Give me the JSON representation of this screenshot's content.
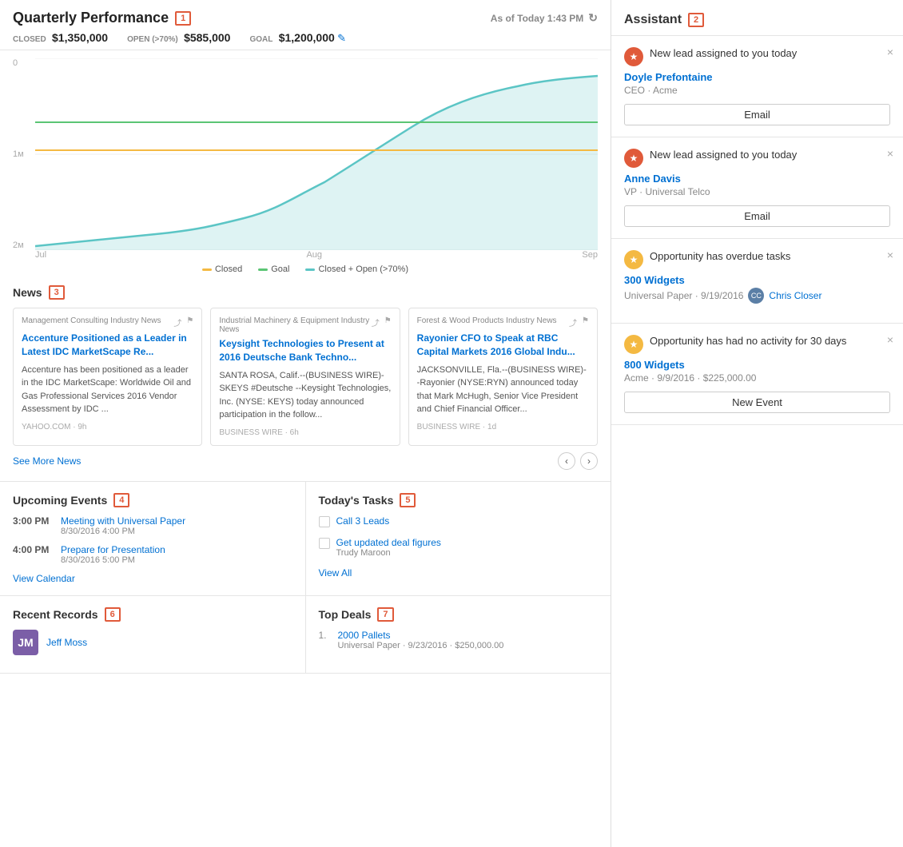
{
  "header": {
    "title": "Quarterly Performance",
    "badge": "1",
    "timestamp": "As of Today 1:43 PM",
    "closed_label": "CLOSED",
    "closed_value": "$1,350,000",
    "open_label": "OPEN (>70%)",
    "open_value": "$585,000",
    "goal_label": "GOAL",
    "goal_value": "$1,200,000"
  },
  "chart": {
    "y_labels": [
      "2м",
      "1м",
      "0"
    ],
    "x_labels": [
      "Jul",
      "Aug",
      "Sep"
    ],
    "legend": [
      {
        "label": "Closed",
        "color": "#f4b942"
      },
      {
        "label": "Goal",
        "color": "#5bc574"
      },
      {
        "label": "Closed + Open (>70%)",
        "color": "#5bc5c5"
      }
    ]
  },
  "news": {
    "section_title": "News",
    "badge": "3",
    "see_more": "See More News",
    "items": [
      {
        "source": "Management Consulting Industry News",
        "headline": "Accenture Positioned as a Leader in Latest IDC MarketScape Re...",
        "body": "Accenture has been positioned as a leader in the IDC MarketScape: Worldwide Oil and Gas Professional Services 2016 Vendor Assessment by IDC ...",
        "time": "YAHOO.COM · 9h"
      },
      {
        "source": "Industrial Machinery & Equipment Industry News",
        "headline": "Keysight Technologies to Present at 2016 Deutsche Bank Techno...",
        "body": "SANTA ROSA, Calif.--(BUSINESS WIRE)- SKEYS #Deutsche --Keysight Technologies, Inc. (NYSE: KEYS) today announced participation in the follow...",
        "time": "BUSINESS WIRE · 6h"
      },
      {
        "source": "Forest & Wood Products Industry News",
        "headline": "Rayonier CFO to Speak at RBC Capital Markets 2016 Global Indu...",
        "body": "JACKSONVILLE, Fla.--(BUSINESS WIRE)--Rayonier (NYSE:RYN) announced today that Mark McHugh, Senior Vice President and Chief Financial Officer...",
        "time": "BUSINESS WIRE · 1d"
      }
    ]
  },
  "upcoming_events": {
    "section_title": "Upcoming Events",
    "badge": "4",
    "items": [
      {
        "time": "3:00 PM",
        "name": "Meeting with Universal Paper",
        "date": "8/30/2016 4:00 PM"
      },
      {
        "time": "4:00 PM",
        "name": "Prepare for Presentation",
        "date": "8/30/2016 5:00 PM"
      }
    ],
    "view_link": "View Calendar"
  },
  "todays_tasks": {
    "section_title": "Today's Tasks",
    "badge": "5",
    "items": [
      {
        "name": "Call 3 Leads",
        "sub": ""
      },
      {
        "name": "Get updated deal figures",
        "sub": "Trudy Maroon"
      }
    ],
    "view_all": "View All"
  },
  "recent_records": {
    "section_title": "Recent Records",
    "badge": "6",
    "items": [
      {
        "name": "Jeff Moss",
        "initials": "JM"
      }
    ]
  },
  "top_deals": {
    "section_title": "Top Deals",
    "badge": "7",
    "items": [
      {
        "num": "1.",
        "name": "2000 Pallets",
        "sub": "Universal Paper · 9/23/2016 · $250,000.00"
      }
    ]
  },
  "assistant": {
    "title": "Assistant",
    "badge": "2",
    "cards": [
      {
        "type": "lead",
        "icon_type": "star",
        "title": "New lead assigned to you today",
        "person": "Doyle Prefontaine",
        "role": "CEO · Acme",
        "button": "Email"
      },
      {
        "type": "lead",
        "icon_type": "star",
        "title": "New lead assigned to you today",
        "person": "Anne Davis",
        "role": "VP · Universal Telco",
        "button": "Email"
      },
      {
        "type": "overdue",
        "icon_type": "gold",
        "title": "Opportunity has overdue tasks",
        "opp": "300 Widgets",
        "sub": "Universal Paper · 9/19/2016",
        "user": "Chris Closer"
      },
      {
        "type": "inactive",
        "icon_type": "gold",
        "title": "Opportunity has had no activity for 30 days",
        "opp": "800 Widgets",
        "sub": "Acme · 9/9/2016 · $225,000.00",
        "button": "New Event"
      }
    ]
  }
}
